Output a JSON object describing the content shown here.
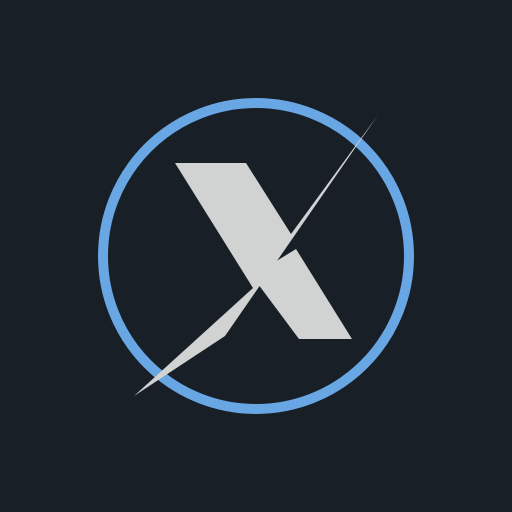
{
  "logo": {
    "icon": "x-circle-logo-icon",
    "colors": {
      "background": "#181f27",
      "ring": "#68a7e3",
      "mark": "#d0d3d2"
    }
  }
}
